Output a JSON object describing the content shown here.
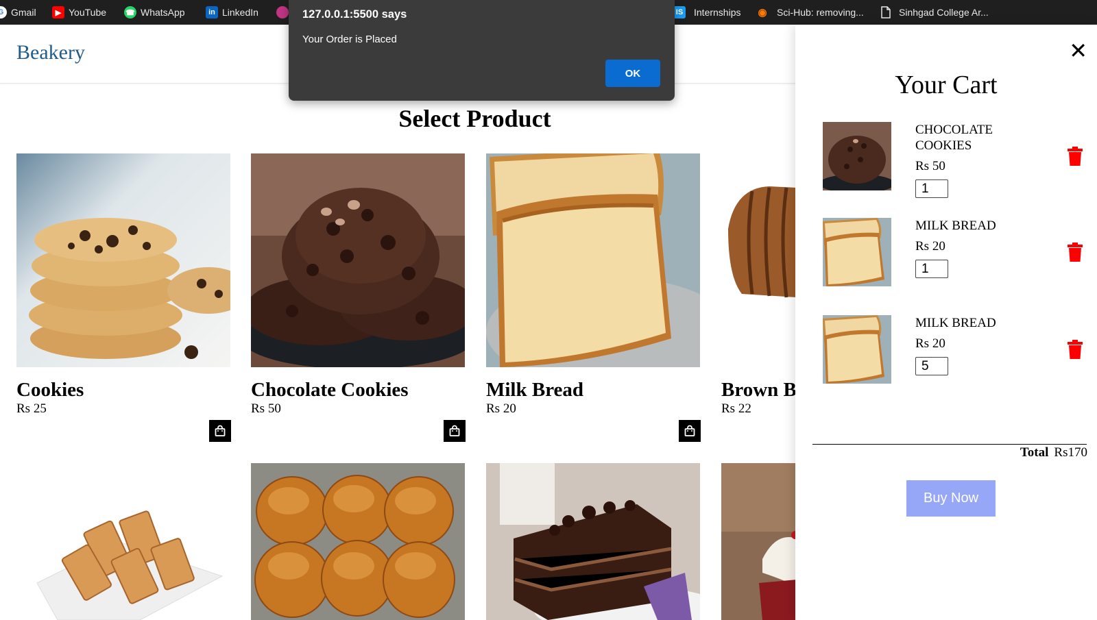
{
  "bookmarks": [
    {
      "label": "Gmail",
      "icon": "google-icon"
    },
    {
      "label": "YouTube",
      "icon": "youtube-icon"
    },
    {
      "label": "WhatsApp",
      "icon": "whatsapp-icon"
    },
    {
      "label": "LinkedIn",
      "icon": "linkedin-icon"
    },
    {
      "label": "Internships",
      "icon": "internshala-icon"
    },
    {
      "label": "Sci-Hub: removing...",
      "icon": "scihub-icon"
    },
    {
      "label": "Sinhgad College Ar...",
      "icon": "document-icon"
    }
  ],
  "header": {
    "logo": "Beakery"
  },
  "main": {
    "section_title": "Select Product"
  },
  "products": [
    {
      "name": "Cookies",
      "price": "Rs 25",
      "image": "cookies-image"
    },
    {
      "name": "Chocolate Cookies",
      "price": "Rs 50",
      "image": "chocolate-cookies-image"
    },
    {
      "name": "Milk Bread",
      "price": "Rs 20",
      "image": "milk-bread-image"
    },
    {
      "name": "Brown B",
      "price": "Rs 22",
      "image": "brown-bread-image"
    }
  ],
  "products_row2": [
    {
      "image": "rusk-image"
    },
    {
      "image": "pav-buns-image"
    },
    {
      "image": "chocolate-cake-image"
    },
    {
      "image": "cupcake-image"
    }
  ],
  "cart": {
    "title": "Your Cart",
    "items": [
      {
        "name": "CHOCOLATE COOKIES",
        "price": "Rs 50",
        "qty": "1"
      },
      {
        "name": "MILK BREAD",
        "price": "Rs 20",
        "qty": "1"
      },
      {
        "name": "MILK BREAD",
        "price": "Rs 20",
        "qty": "5"
      }
    ],
    "total_label": "Total",
    "total_value": "Rs170",
    "buy_label": "Buy Now",
    "close_icon": "close-icon"
  },
  "alert": {
    "origin": "127.0.0.1:5500 says",
    "message": "Your Order is Placed",
    "ok_label": "OK"
  },
  "colors": {
    "logo": "#1f5c8a",
    "trash": "#ff0000",
    "buy_button": "#97a7f8",
    "alert_bg": "#3b3b3b",
    "ok_button": "#0a6bd0"
  }
}
